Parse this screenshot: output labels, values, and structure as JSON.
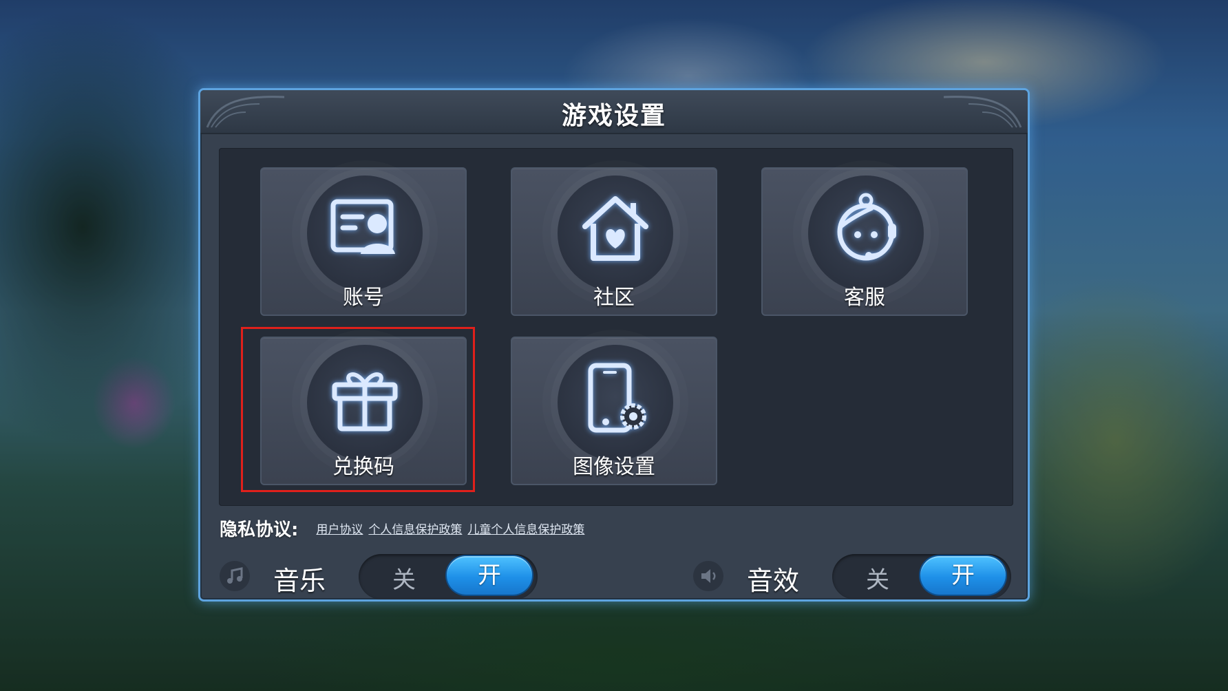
{
  "panel": {
    "title": "游戏设置"
  },
  "tiles": [
    {
      "label": "账号",
      "icon": "account-card-icon"
    },
    {
      "label": "社区",
      "icon": "community-house-heart-icon"
    },
    {
      "label": "客服",
      "icon": "customer-service-headset-icon"
    },
    {
      "label": "兑换码",
      "icon": "gift-box-icon"
    },
    {
      "label": "图像设置",
      "icon": "phone-settings-icon"
    }
  ],
  "privacy": {
    "title": "隐私协议:",
    "links": [
      "用户协议",
      "个人信息保护政策",
      "儿童个人信息保护政策"
    ]
  },
  "music": {
    "label": "音乐",
    "icon": "music-note-icon",
    "off_label": "关",
    "on_label": "开",
    "state": "on"
  },
  "sound": {
    "label": "音效",
    "icon": "speaker-icon",
    "off_label": "关",
    "on_label": "开",
    "state": "on"
  },
  "colors": {
    "accent": "#1e90e8",
    "panel_border": "#5ea4e0",
    "highlight_border": "#e0201b"
  }
}
